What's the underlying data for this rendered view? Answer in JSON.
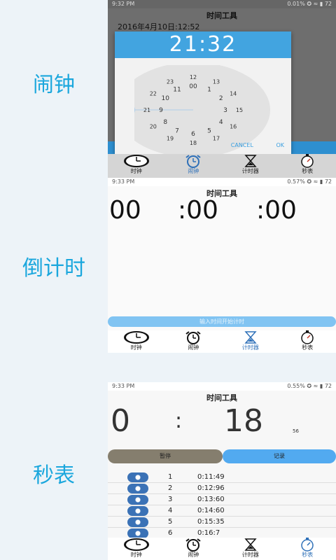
{
  "labels": {
    "alarm": "闹钟",
    "countdown": "倒计时",
    "stopwatch": "秒表"
  },
  "nav": {
    "clock": "时钟",
    "alarm": "闹钟",
    "timer": "计时器",
    "stopwatch": "秒表"
  },
  "panel1": {
    "status_time": "9:32 PM",
    "status_right": "0.01% ✪ ≈ ▮ 72",
    "title": "时间工具",
    "datetime": "2016年4月10日:12:52",
    "dialog_time": "21:32",
    "outer_hours": [
      "00",
      "1",
      "2",
      "3",
      "4",
      "5",
      "6",
      "7",
      "8",
      "9",
      "10",
      "11"
    ],
    "inner_hours": [
      "12",
      "13",
      "14",
      "15",
      "16",
      "17",
      "18",
      "19",
      "20",
      "21",
      "22",
      "23"
    ],
    "cancel": "CANCEL",
    "ok": "OK"
  },
  "panel2": {
    "status_time": "9:33 PM",
    "status_right": "0.57% ✪ ≈ ▮ 72",
    "title": "时间工具",
    "hours": "00",
    "minutes": ":00",
    "seconds": ":00",
    "input_placeholder": "输入时间开始计时"
  },
  "panel3": {
    "status_time": "9:33 PM",
    "status_right": "0.55% ✪ ≈ ▮ 72",
    "title": "时间工具",
    "minutes": "0",
    "colon": ":",
    "seconds": "18",
    "ms": "56",
    "pause": "暂停",
    "record": "记录",
    "laps": [
      {
        "n": "1",
        "t": "0:11:49"
      },
      {
        "n": "2",
        "t": "0:12:96"
      },
      {
        "n": "3",
        "t": "0:13:60"
      },
      {
        "n": "4",
        "t": "0:14:60"
      },
      {
        "n": "5",
        "t": "0:15:35"
      },
      {
        "n": "6",
        "t": "0:16:7"
      }
    ]
  },
  "colors": {
    "accent": "#42a4e0",
    "label": "#1ba7dd",
    "pause_bg": "#857e6e",
    "record_bg": "#52aaf0"
  }
}
